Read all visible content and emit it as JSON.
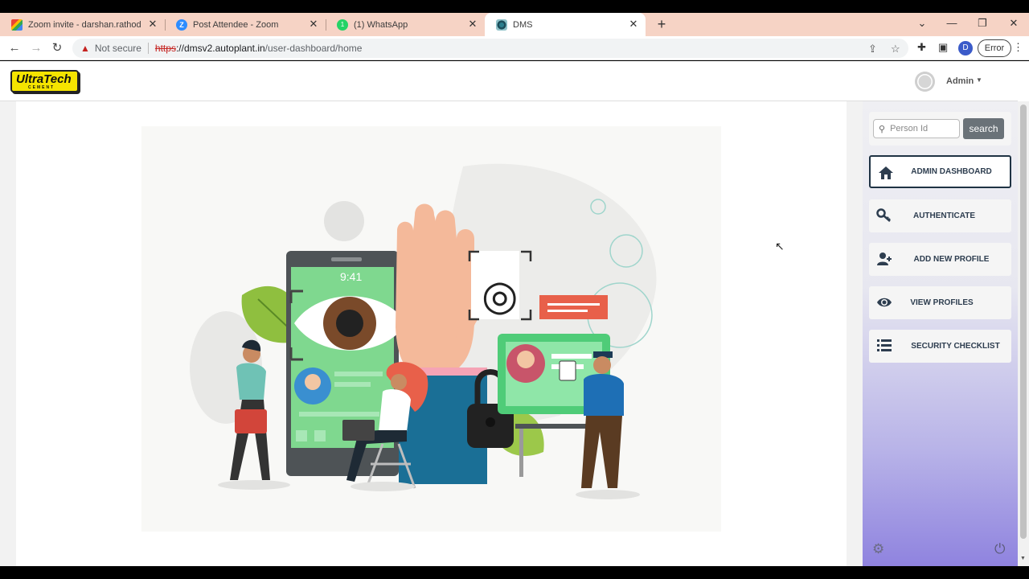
{
  "browser": {
    "tabs": [
      {
        "title": "Zoom invite - darshan.rathod@d",
        "favicon": "gmail-icon"
      },
      {
        "title": "Post Attendee - Zoom",
        "favicon": "zoom-icon"
      },
      {
        "title": "(1) WhatsApp",
        "favicon": "whatsapp-icon"
      },
      {
        "title": "DMS",
        "favicon": "dms-icon"
      }
    ],
    "address": {
      "security_label": "Not secure",
      "scheme": "https",
      "host": "://dmsv2.autoplant.in",
      "path": "/user-dashboard/home"
    },
    "profile_initial": "D",
    "error_label": "Error"
  },
  "header": {
    "logo_text": "UltraTech",
    "logo_subtext": "CEMENT",
    "user_name": "Admin"
  },
  "sidebar": {
    "search": {
      "placeholder": "Person Id",
      "button_label": "search"
    },
    "items": [
      {
        "label": "ADMIN DASHBOARD",
        "icon": "home-icon"
      },
      {
        "label": "AUTHENTICATE",
        "icon": "key-icon"
      },
      {
        "label": "ADD NEW PROFILE",
        "icon": "add-user-icon"
      },
      {
        "label": "VIEW PROFILES",
        "icon": "eye-icon"
      },
      {
        "label": "SECURITY CHECKLIST",
        "icon": "list-icon"
      }
    ]
  },
  "illustration": {
    "phone_time": "9:41"
  },
  "colors": {
    "sidebar_active_border": "#1f3344",
    "search_button": "#6a7278",
    "tab_strip": "#f6d3c5"
  }
}
